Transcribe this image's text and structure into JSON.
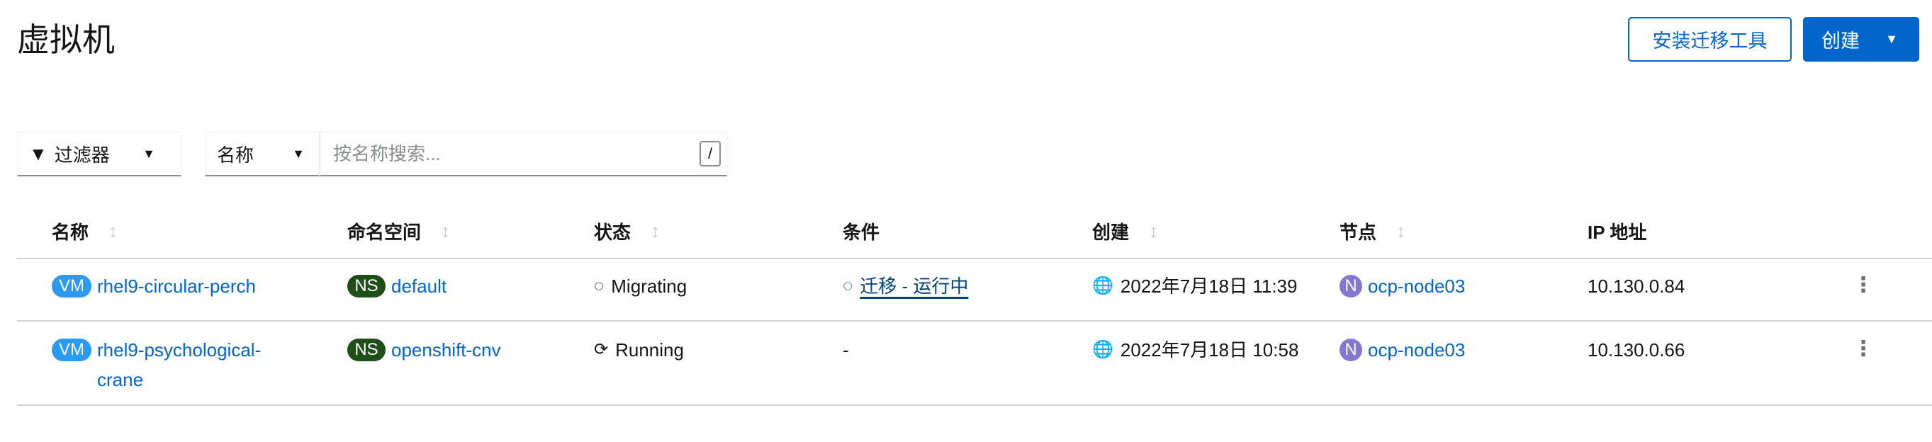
{
  "page": {
    "title": "虚拟机"
  },
  "toolbar": {
    "install_label": "安装迁移工具",
    "create_label": "创建",
    "filter_label": "过滤器",
    "attr_label": "名称",
    "search_placeholder": "按名称搜索...",
    "shortcut": "/"
  },
  "table": {
    "headers": [
      "名称",
      "命名空间",
      "状态",
      "条件",
      "创建",
      "节点",
      "IP 地址"
    ],
    "rows": [
      {
        "badge": "VM",
        "name": "rhel9-circular-perch",
        "ns_badge": "NS",
        "namespace": "default",
        "status": "Migrating",
        "condition": "迁移 - 运行中",
        "created": "2022年7月18日 11:39",
        "node_badge": "N",
        "node": "ocp-node03",
        "ip": "10.130.0.84"
      },
      {
        "badge": "VM",
        "name": "rhel9-psychological-crane",
        "ns_badge": "NS",
        "namespace": "openshift-cnv",
        "status": "Running",
        "condition": "-",
        "created": "2022年7月18日 10:58",
        "node_badge": "N",
        "node": "ocp-node03",
        "ip": "10.130.0.66"
      }
    ]
  },
  "colors": {
    "primary": "#0066cc",
    "vm": "#2b9af3",
    "ns": "#1e4f18",
    "node": "#8476d1"
  }
}
